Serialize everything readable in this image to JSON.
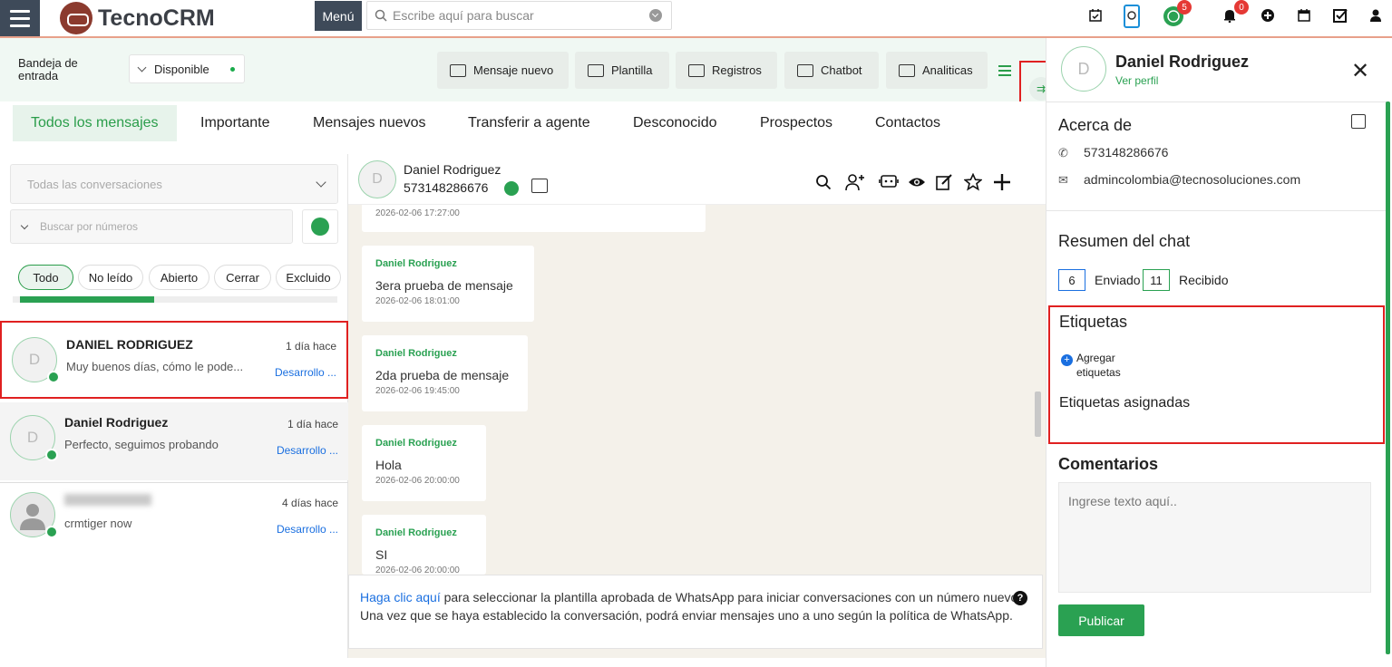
{
  "app": {
    "brand": "TecnoCRM",
    "menu_label": "Menú",
    "search_placeholder": "Escribe aquí para buscar"
  },
  "topbar_icons": [
    {
      "name": "calendar-check-icon"
    },
    {
      "name": "mobile-icon"
    },
    {
      "name": "balance-icon",
      "badge": "5"
    },
    {
      "name": "bell-icon",
      "badge": "0"
    },
    {
      "name": "plus-circle-icon"
    },
    {
      "name": "calendar-icon"
    },
    {
      "name": "checkbox-icon"
    },
    {
      "name": "user-icon"
    }
  ],
  "toolbar": {
    "inbox_label": "Bandeja de entrada",
    "status": "Disponible",
    "buttons": [
      "Mensaje nuevo",
      "Plantilla",
      "Registros",
      "Chatbot",
      "Analiticas"
    ]
  },
  "tabs": [
    "Todos los mensajes",
    "Importante",
    "Mensajes nuevos",
    "Transferir a agente",
    "Desconocido",
    "Prospectos",
    "Contactos"
  ],
  "left": {
    "conv_filter": "Todas las conversaciones",
    "number_search": "Buscar por números",
    "chips": [
      "Todo",
      "No leído",
      "Abierto",
      "Cerrar",
      "Excluido"
    ],
    "conversations": [
      {
        "name": "DANIEL RODRIGUEZ",
        "time": "1 día hace",
        "preview": "Muy buenos días, cómo le pode...",
        "dept": "Desarrollo ...",
        "initial": "D"
      },
      {
        "name": "Daniel Rodriguez",
        "time": "1 día hace",
        "preview": "Perfecto, seguimos probando",
        "dept": "Desarrollo ...",
        "initial": "D"
      },
      {
        "name": "",
        "time": "4 días hace",
        "preview": "crmtiger now",
        "dept": "Desarrollo ...",
        "initial": ""
      }
    ]
  },
  "chat": {
    "header_name": "Daniel Rodriguez",
    "header_number": "573148286676",
    "initial": "D",
    "messages": [
      {
        "sender": "",
        "text": "",
        "time": "2026-02-06 17:27:00"
      },
      {
        "sender": "Daniel Rodriguez",
        "text": "3era prueba de mensaje",
        "time": "2026-02-06 18:01:00"
      },
      {
        "sender": "Daniel Rodriguez",
        "text": "2da prueba de mensaje",
        "time": "2026-02-06 19:45:00"
      },
      {
        "sender": "Daniel Rodriguez",
        "text": "Hola",
        "time": "2026-02-06 20:00:00"
      },
      {
        "sender": "Daniel Rodriguez",
        "text": "SI",
        "time": "2026-02-06 20:00:00"
      }
    ],
    "notice_link": "Haga clic aquí",
    "notice_text": " para seleccionar la plantilla aprobada de WhatsApp para iniciar conversaciones con un número nuevo. Una vez que se haya establecido la conversación, podrá enviar mensajes uno a uno según la política de WhatsApp."
  },
  "profile": {
    "initial": "D",
    "name": "Daniel Rodriguez",
    "link": "Ver perfil",
    "about_title": "Acerca de",
    "phone": "573148286676",
    "email": "admincolombia@tecnosoluciones.com",
    "summary_title": "Resumen del chat",
    "sent_count": "6",
    "sent_label": "Enviado",
    "received_count": "11",
    "received_label": "Recibido",
    "tags_title": "Etiquetas",
    "add_tags": "Agregar etiquetas",
    "assigned_tags": "Etiquetas asignadas",
    "comments_title": "Comentarios",
    "comment_placeholder": "Ingrese texto aquí..",
    "publish": "Publicar"
  }
}
